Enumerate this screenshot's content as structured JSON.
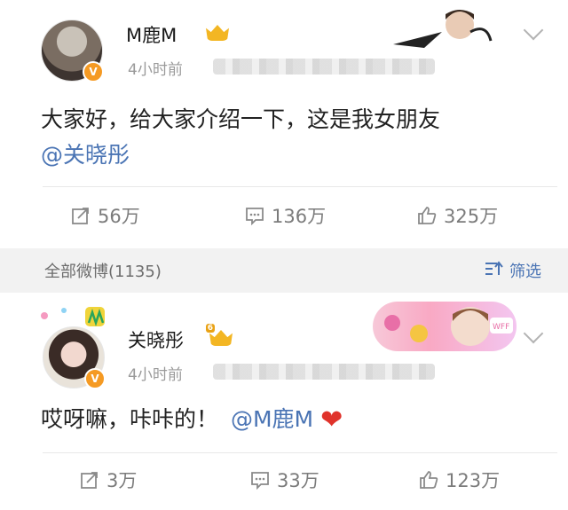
{
  "post1": {
    "username": "M鹿M",
    "time": "4小时前",
    "text": "大家好，给大家介绍一下，这是我女朋友",
    "mention": "@关晓彤",
    "repost_count": "56万",
    "comment_count": "136万",
    "like_count": "325万"
  },
  "filter_bar": {
    "all_label": "全部微博(1135)",
    "filter_label": "筛选"
  },
  "post2": {
    "username": "关晓彤",
    "time": "4小时前",
    "text": "哎呀嘛，咔咔的！",
    "mention": "@M鹿M",
    "repost_count": "3万",
    "comment_count": "33万",
    "like_count": "123万",
    "crown_level": "6"
  },
  "colors": {
    "mention": "#4a74b4",
    "badge": "#f59a23",
    "crown": "#f3b623",
    "heart": "#e0332b"
  }
}
